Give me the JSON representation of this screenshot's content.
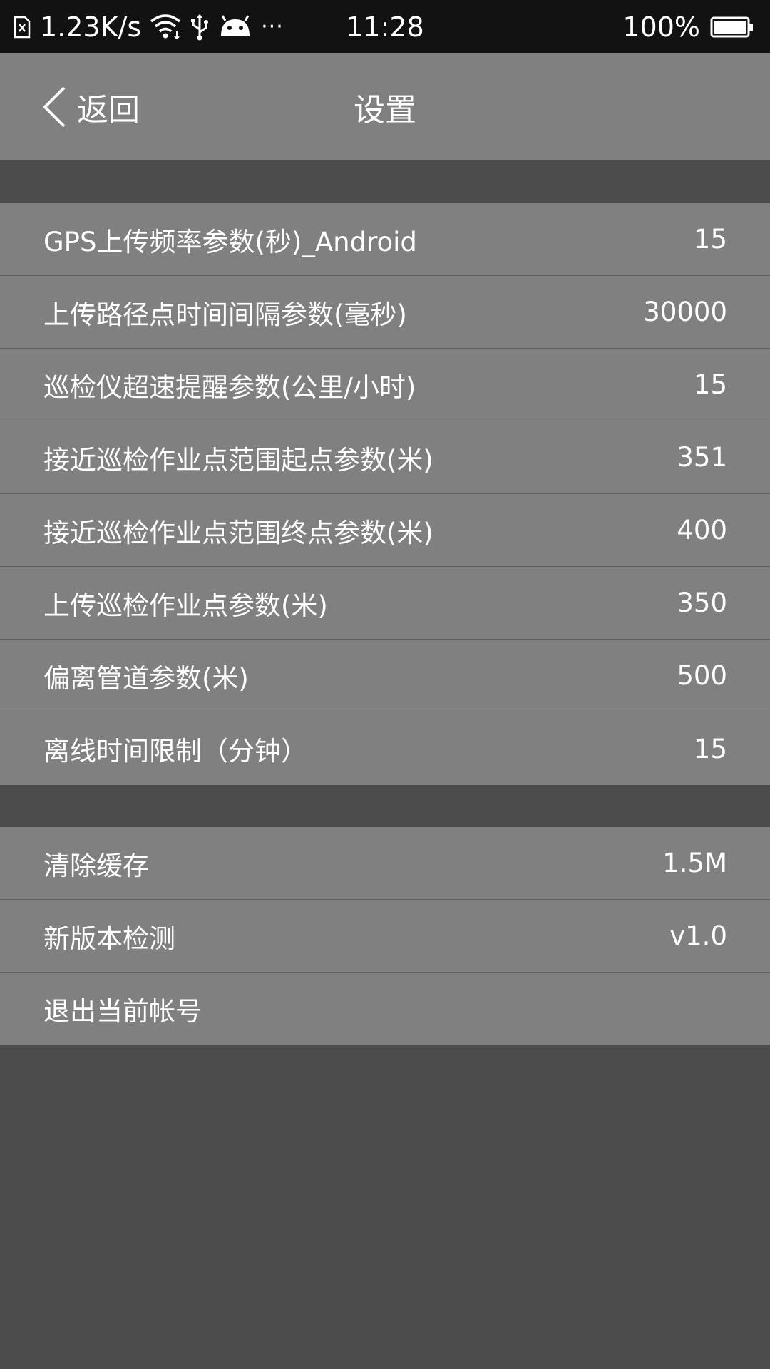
{
  "status_bar": {
    "network_speed": "1.23K/s",
    "time": "11:28",
    "battery": "100%",
    "more": "···",
    "icons": [
      "sim-card-icon",
      "wifi-icon",
      "usb-icon",
      "android-icon",
      "battery-icon"
    ]
  },
  "header": {
    "back_label": "返回",
    "title": "设置"
  },
  "settings": {
    "items": [
      {
        "label": "GPS上传频率参数(秒)_Android",
        "value": "15"
      },
      {
        "label": "上传路径点时间间隔参数(毫秒)",
        "value": "30000"
      },
      {
        "label": "巡检仪超速提醒参数(公里/小时)",
        "value": "15"
      },
      {
        "label": "接近巡检作业点范围起点参数(米)",
        "value": "351"
      },
      {
        "label": "接近巡检作业点范围终点参数(米)",
        "value": "400"
      },
      {
        "label": "上传巡检作业点参数(米)",
        "value": "350"
      },
      {
        "label": "偏离管道参数(米)",
        "value": "500"
      },
      {
        "label": "离线时间限制（分钟）",
        "value": "15"
      }
    ]
  },
  "system": {
    "items": [
      {
        "label": "清除缓存",
        "value": "1.5M"
      },
      {
        "label": "新版本检测",
        "value": "v1.0"
      },
      {
        "label": "退出当前帐号",
        "value": ""
      }
    ]
  },
  "colors": {
    "status_bar_bg": "#121212",
    "row_bg": "#808080",
    "page_bg": "#4a4b4a",
    "divider": "#5f5f5f",
    "text": "#ffffff"
  }
}
